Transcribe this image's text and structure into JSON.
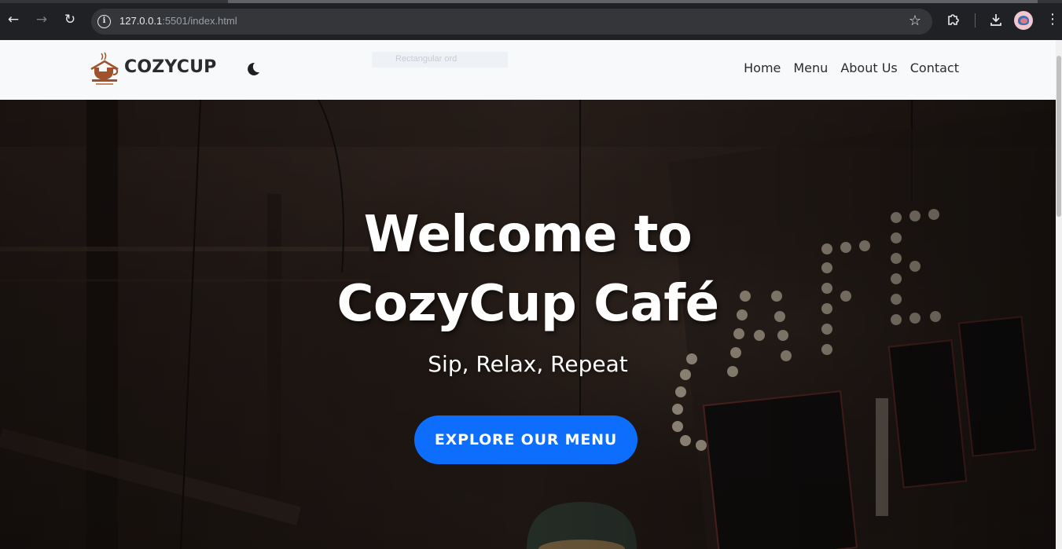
{
  "browser": {
    "url_host": "127.0.0.1",
    "url_rest": ":5501/index.html",
    "icons": {
      "back": "arrow-left-icon",
      "forward": "arrow-right-icon",
      "reload": "reload-icon",
      "site_info": "info-icon",
      "bookmark": "star-icon",
      "extensions": "puzzle-icon",
      "downloads": "download-icon",
      "profile": "avatar",
      "menu": "kebab-menu-icon"
    }
  },
  "navbar": {
    "brand": "COZYCUP",
    "theme_icon": "moon-icon",
    "broken_image_alt": "Rectangular ord",
    "links": [
      "Home",
      "Menu",
      "About Us",
      "Contact"
    ]
  },
  "hero": {
    "title_line1": "Welcome to",
    "title_line2": "CozyCup Café",
    "subtitle": "Sip, Relax, Repeat",
    "cta": "EXPLORE OUR MENU"
  },
  "colors": {
    "chrome_bg": "#202124",
    "omnibox_bg": "#35363a",
    "navbar_bg": "#f8f9fa",
    "brand_text": "#2b2b2b",
    "cta_blue": "#0d6efd",
    "logo_brown": "#a0522d"
  }
}
